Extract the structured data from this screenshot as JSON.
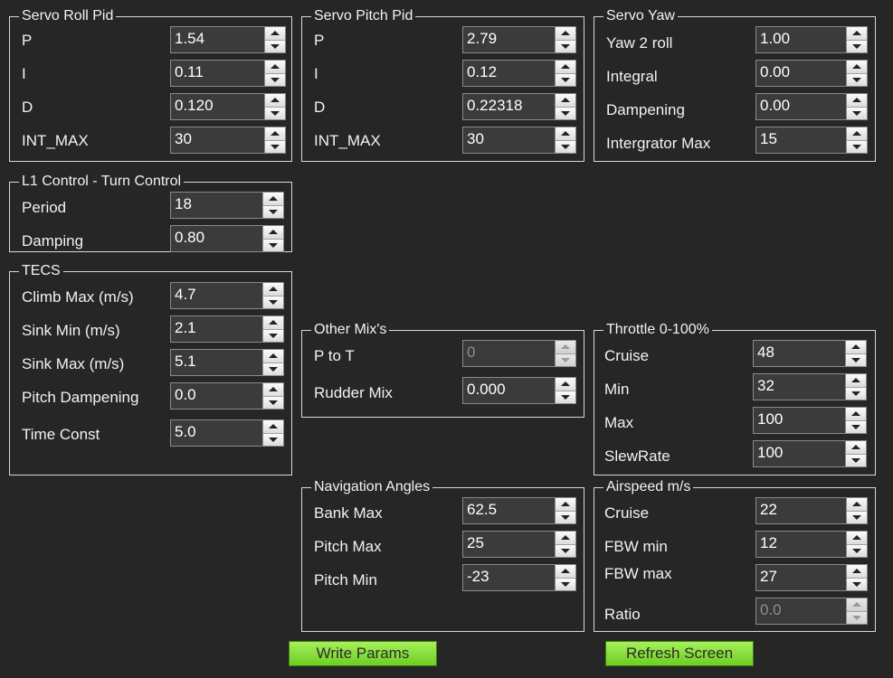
{
  "servo_roll": {
    "title": "Servo Roll Pid",
    "rows": [
      {
        "label": "P",
        "value": "1.54"
      },
      {
        "label": "I",
        "value": "0.11"
      },
      {
        "label": "D",
        "value": "0.120"
      },
      {
        "label": "INT_MAX",
        "value": "30"
      }
    ]
  },
  "servo_pitch": {
    "title": "Servo Pitch Pid",
    "rows": [
      {
        "label": "P",
        "value": "2.79"
      },
      {
        "label": "I",
        "value": "0.12"
      },
      {
        "label": "D",
        "value": "0.22318"
      },
      {
        "label": "INT_MAX",
        "value": "30"
      }
    ]
  },
  "servo_yaw": {
    "title": "Servo Yaw",
    "rows": [
      {
        "label": "Yaw 2 roll",
        "value": "1.00"
      },
      {
        "label": "Integral",
        "value": "0.00"
      },
      {
        "label": "Dampening",
        "value": "0.00"
      },
      {
        "label": "Intergrator Max",
        "value": "15"
      }
    ]
  },
  "l1": {
    "title": "L1 Control - Turn Control",
    "rows": [
      {
        "label": "Period",
        "value": "18"
      },
      {
        "label": "Damping",
        "value": "0.80"
      }
    ]
  },
  "tecs": {
    "title": "TECS",
    "rows": [
      {
        "label": "Climb Max (m/s)",
        "value": "4.7"
      },
      {
        "label": "Sink Min (m/s)",
        "value": "2.1"
      },
      {
        "label": "Sink Max (m/s)",
        "value": "5.1"
      },
      {
        "label": "Pitch Dampening",
        "value": "0.0"
      },
      {
        "label": "Time Const",
        "value": "5.0"
      }
    ]
  },
  "other_mix": {
    "title": "Other Mix's",
    "rows": [
      {
        "label": "P to T",
        "value": "0",
        "disabled": true
      },
      {
        "label": "Rudder Mix",
        "value": "0.000"
      }
    ]
  },
  "throttle": {
    "title": "Throttle 0-100%",
    "rows": [
      {
        "label": "Cruise",
        "value": "48"
      },
      {
        "label": "Min",
        "value": "32"
      },
      {
        "label": "Max",
        "value": "100"
      },
      {
        "label": "SlewRate",
        "value": "100"
      }
    ]
  },
  "nav": {
    "title": "Navigation Angles",
    "rows": [
      {
        "label": "Bank Max",
        "value": "62.5"
      },
      {
        "label": "Pitch Max",
        "value": "25"
      },
      {
        "label": "Pitch Min",
        "value": "-23"
      }
    ]
  },
  "airspeed": {
    "title": "Airspeed m/s",
    "rows": [
      {
        "label": "Cruise",
        "value": "22"
      },
      {
        "label": "FBW min",
        "value": "12"
      },
      {
        "label": "FBW max",
        "value": "27"
      },
      {
        "label": "Ratio",
        "value": "0.0",
        "disabled": true
      }
    ]
  },
  "buttons": {
    "write": "Write Params",
    "refresh": "Refresh Screen"
  },
  "colors": {
    "background": "#262626",
    "button_green": "#8ee03e"
  }
}
